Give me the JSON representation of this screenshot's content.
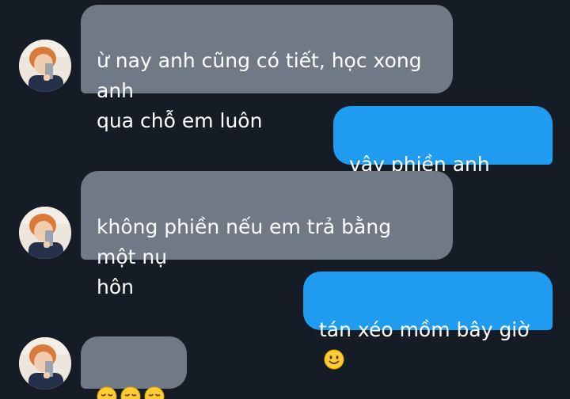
{
  "conversation": {
    "messages": [
      {
        "sender": "other",
        "text": "ừ nay anh cũng có tiết, học xong anh\nqua chỗ em luôn"
      },
      {
        "sender": "me",
        "text": "vậy phiền anh nhaaa"
      },
      {
        "sender": "other",
        "text": "không phiền nếu em trả bằng một nụ\nhôn"
      },
      {
        "sender": "me",
        "text": "tán xéo mồm bây giờ",
        "emoji": "slightly-smiling-face"
      },
      {
        "sender": "other",
        "emojis": [
          "disappointed-face",
          "disappointed-face",
          "disappointed-face"
        ]
      }
    ]
  },
  "colors": {
    "background": "#161c25",
    "incoming_bubble": "#6f7a86",
    "outgoing_bubble": "#1f9bf0",
    "text": "#ffffff",
    "emoji_yellow": "#ffcc33"
  }
}
